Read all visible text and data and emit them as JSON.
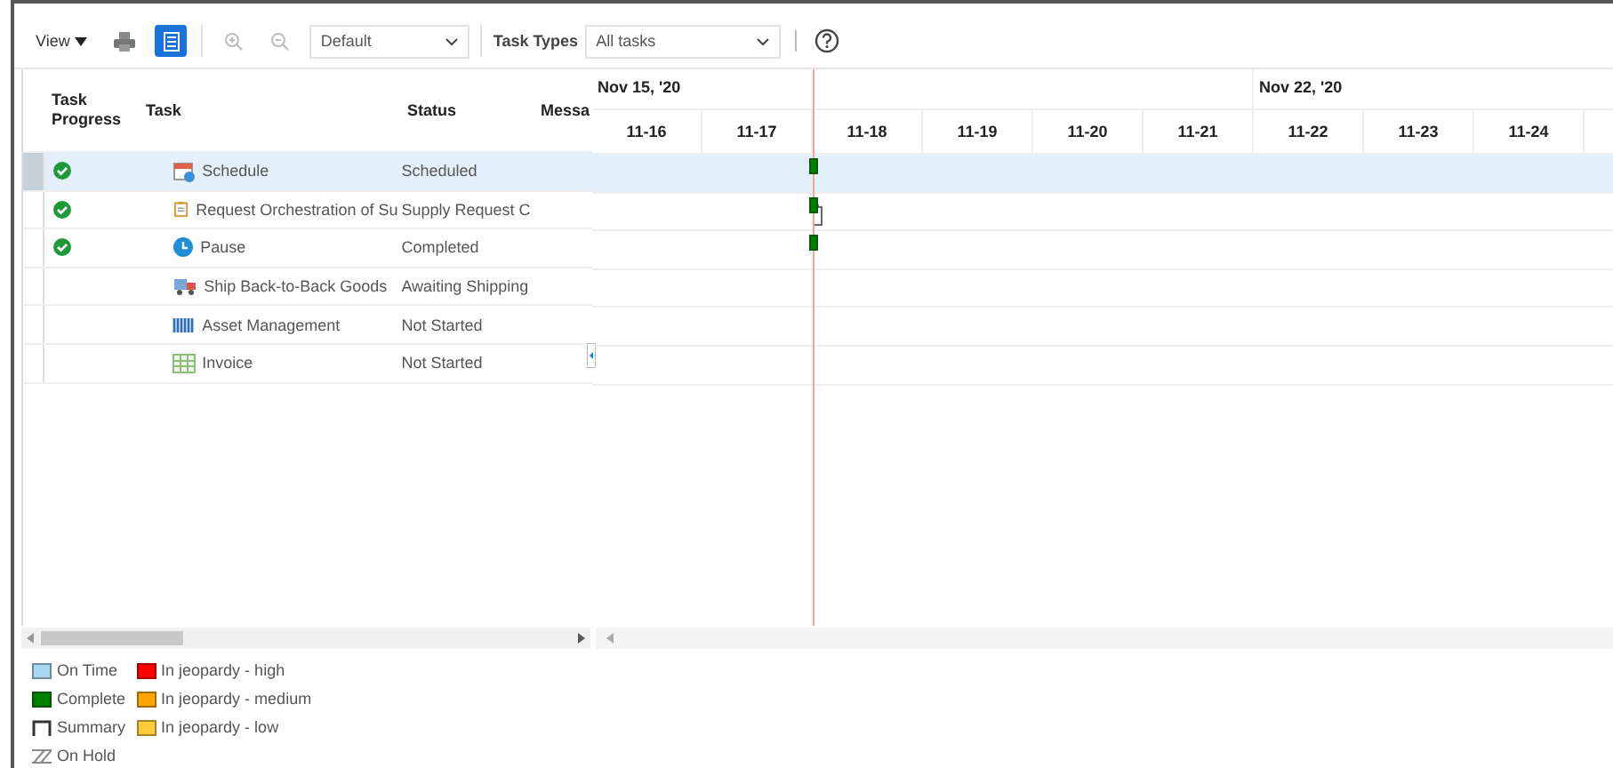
{
  "toolbar": {
    "view_menu": "View",
    "layout_toggle": {
      "selected": true
    },
    "zoom_in": {
      "disabled": true
    },
    "zoom_out": {
      "disabled": true
    },
    "view_select": "Default",
    "task_types_label": "Task Types",
    "task_types_select": "All tasks"
  },
  "table": {
    "columns": [
      "Task Progress",
      "Task",
      "Status",
      "Messa"
    ],
    "rows": [
      {
        "progress_complete": true,
        "task": "Schedule",
        "status": "Scheduled",
        "selected": true,
        "bar_complete": true
      },
      {
        "progress_complete": true,
        "task": "Request Orchestration of Su",
        "status": "Supply Request C",
        "selected": false,
        "bar_complete": true
      },
      {
        "progress_complete": true,
        "task": "Pause",
        "status": "Completed",
        "selected": false,
        "bar_complete": true
      },
      {
        "progress_complete": false,
        "task": "Ship Back-to-Back Goods",
        "status": "Awaiting Shipping",
        "selected": false,
        "bar_complete": false
      },
      {
        "progress_complete": false,
        "task": "Asset Management",
        "status": "Not Started",
        "selected": false,
        "bar_complete": false
      },
      {
        "progress_complete": false,
        "task": "Invoice",
        "status": "Not Started",
        "selected": false,
        "bar_complete": false
      }
    ]
  },
  "gantt": {
    "weeks": [
      "Nov 15, '20",
      "Nov 22, '20"
    ],
    "days": [
      "11-16",
      "11-17",
      "11-18",
      "11-19",
      "11-20",
      "11-21",
      "11-22",
      "11-23",
      "11-24"
    ]
  },
  "legend": [
    {
      "label": "On Time",
      "kind": "swatch",
      "color": "#a8d8f0"
    },
    {
      "label": "Complete",
      "kind": "swatch",
      "color": "#008000"
    },
    {
      "label": "Summary",
      "kind": "summary"
    },
    {
      "label": "On Hold",
      "kind": "hatch"
    },
    {
      "label": "In jeopardy - high",
      "kind": "swatch",
      "color": "#ff0000"
    },
    {
      "label": "In jeopardy - medium",
      "kind": "swatch",
      "color": "#ffa500"
    },
    {
      "label": "In jeopardy - low",
      "kind": "swatch",
      "color": "#ffc93c"
    }
  ]
}
